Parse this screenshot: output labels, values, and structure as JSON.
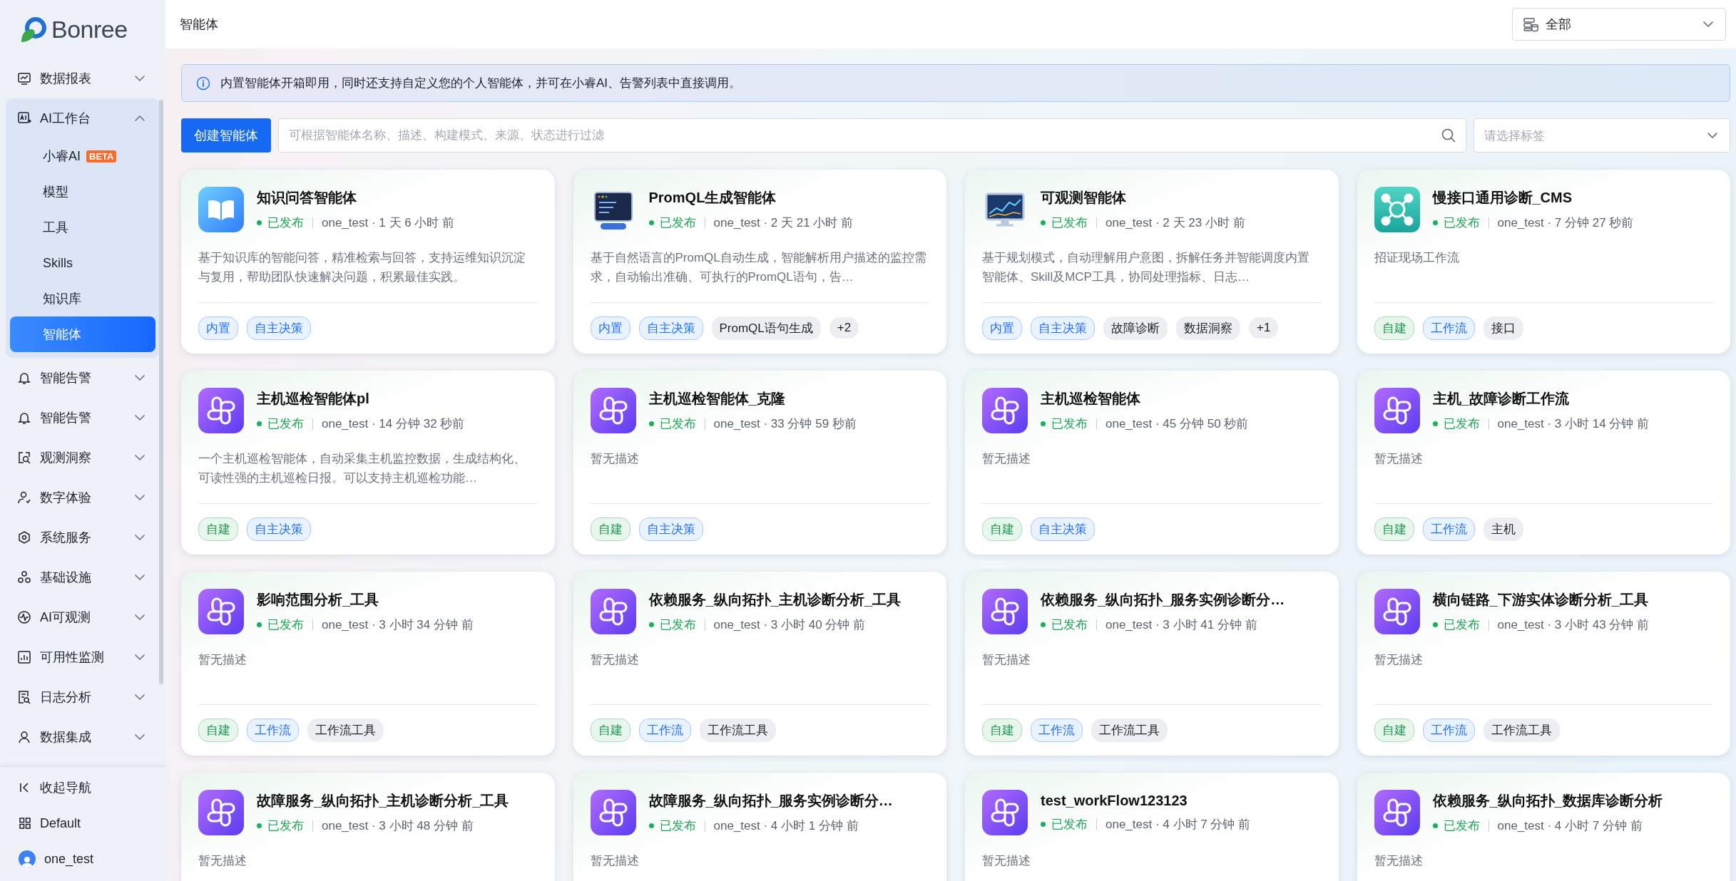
{
  "sidebar": {
    "logo": "Bonree",
    "items": [
      {
        "label": "数据报表",
        "expanded": false
      },
      {
        "label": "AI工作台",
        "expanded": true,
        "children": [
          {
            "label": "小睿AI",
            "badge": "BETA",
            "selected": false
          },
          {
            "label": "模型",
            "selected": false
          },
          {
            "label": "工具",
            "selected": false
          },
          {
            "label": "Skills",
            "selected": false
          },
          {
            "label": "知识库",
            "selected": false
          },
          {
            "label": "智能体",
            "selected": true
          }
        ]
      },
      {
        "label": "智能告警",
        "expanded": false
      },
      {
        "label": "智能告警",
        "expanded": false
      },
      {
        "label": "观测洞察",
        "expanded": false
      },
      {
        "label": "数字体验",
        "expanded": false
      },
      {
        "label": "系统服务",
        "expanded": false
      },
      {
        "label": "基础设施",
        "expanded": false
      },
      {
        "label": "AI可观测",
        "expanded": false
      },
      {
        "label": "可用性监测",
        "expanded": false
      },
      {
        "label": "日志分析",
        "expanded": false
      },
      {
        "label": "数据集成",
        "expanded": false
      }
    ],
    "footer": {
      "collapse": "收起导航",
      "workspace": "Default",
      "user": "one_test"
    }
  },
  "header": {
    "title": "智能体",
    "scope_select": "全部"
  },
  "banner": "内置智能体开箱即用，同时还支持自定义您的个人智能体，并可在小睿AI、告警列表中直接调用。",
  "toolbar": {
    "create_button": "创建智能体",
    "search": {
      "placeholder": "可根据智能体名称、描述、构建模式、来源、状态进行过滤"
    },
    "tag_select": {
      "placeholder": "请选择标签"
    }
  },
  "cards": [
    {
      "kind": "book",
      "title": "知识问答智能体",
      "status": "已发布",
      "meta": "one_test · 1 天 6 小时 前",
      "description": "基于知识库的智能问答，精准检索与回答，支持运维知识沉淀与复用，帮助团队快速解决问题，积累最佳实践。",
      "tags": [
        {
          "label": "内置",
          "kind": "source"
        },
        {
          "label": "自主决策",
          "kind": "mode"
        }
      ]
    },
    {
      "kind": "terminal",
      "title": "PromQL生成智能体",
      "status": "已发布",
      "meta": "one_test · 2 天 21 小时 前",
      "description": "基于自然语言的PromQL自动生成，智能解析用户描述的监控需求，自动输出准确、可执行的PromQL语句，告…",
      "tags": [
        {
          "label": "内置",
          "kind": "source"
        },
        {
          "label": "自主决策",
          "kind": "mode"
        },
        {
          "label": "PromQL语句生成",
          "kind": "label"
        },
        {
          "label": "+2",
          "kind": "label"
        }
      ]
    },
    {
      "kind": "monitor",
      "title": "可观测智能体",
      "status": "已发布",
      "meta": "one_test · 2 天 23 小时 前",
      "description": "基于规划模式，自动理解用户意图，拆解任务并智能调度内置智能体、Skill及MCP工具，协同处理指标、日志…",
      "tags": [
        {
          "label": "内置",
          "kind": "source"
        },
        {
          "label": "自主决策",
          "kind": "mode"
        },
        {
          "label": "故障诊断",
          "kind": "label"
        },
        {
          "label": "数据洞察",
          "kind": "label"
        },
        {
          "label": "+1",
          "kind": "label"
        }
      ]
    },
    {
      "kind": "network",
      "title": "慢接口通用诊断_CMS",
      "status": "已发布",
      "meta": "one_test · 7 分钟 27 秒前",
      "description": "招证现场工作流",
      "tags": [
        {
          "label": "自建",
          "kind": "custom"
        },
        {
          "label": "工作流",
          "kind": "mode"
        },
        {
          "label": "接口",
          "kind": "label"
        }
      ]
    },
    {
      "kind": "workflow",
      "title": "主机巡检智能体pl",
      "status": "已发布",
      "meta": "one_test · 14 分钟 32 秒前",
      "description": "一个主机巡检智能体，自动采集主机监控数据，生成结构化、可读性强的主机巡检日报。可以支持主机巡检功能…",
      "tags": [
        {
          "label": "自建",
          "kind": "custom"
        },
        {
          "label": "自主决策",
          "kind": "mode"
        }
      ]
    },
    {
      "kind": "workflow",
      "title": "主机巡检智能体_克隆",
      "status": "已发布",
      "meta": "one_test · 33 分钟 59 秒前",
      "description": "暂无描述",
      "tags": [
        {
          "label": "自建",
          "kind": "custom"
        },
        {
          "label": "自主决策",
          "kind": "mode"
        }
      ]
    },
    {
      "kind": "workflow",
      "title": "主机巡检智能体",
      "status": "已发布",
      "meta": "one_test · 45 分钟 50 秒前",
      "description": "暂无描述",
      "tags": [
        {
          "label": "自建",
          "kind": "custom"
        },
        {
          "label": "自主决策",
          "kind": "mode"
        }
      ]
    },
    {
      "kind": "workflow",
      "title": "主机_故障诊断工作流",
      "status": "已发布",
      "meta": "one_test · 3 小时 14 分钟 前",
      "description": "暂无描述",
      "tags": [
        {
          "label": "自建",
          "kind": "custom"
        },
        {
          "label": "工作流",
          "kind": "mode"
        },
        {
          "label": "主机",
          "kind": "label"
        }
      ]
    },
    {
      "kind": "workflow",
      "title": "影响范围分析_工具",
      "status": "已发布",
      "meta": "one_test · 3 小时 34 分钟 前",
      "description": "暂无描述",
      "tags": [
        {
          "label": "自建",
          "kind": "custom"
        },
        {
          "label": "工作流",
          "kind": "mode"
        },
        {
          "label": "工作流工具",
          "kind": "label"
        }
      ]
    },
    {
      "kind": "workflow",
      "title": "依赖服务_纵向拓扑_主机诊断分析_工具",
      "status": "已发布",
      "meta": "one_test · 3 小时 40 分钟 前",
      "description": "暂无描述",
      "tags": [
        {
          "label": "自建",
          "kind": "custom"
        },
        {
          "label": "工作流",
          "kind": "mode"
        },
        {
          "label": "工作流工具",
          "kind": "label"
        }
      ]
    },
    {
      "kind": "workflow",
      "title": "依赖服务_纵向拓扑_服务实例诊断分…",
      "status": "已发布",
      "meta": "one_test · 3 小时 41 分钟 前",
      "description": "暂无描述",
      "tags": [
        {
          "label": "自建",
          "kind": "custom"
        },
        {
          "label": "工作流",
          "kind": "mode"
        },
        {
          "label": "工作流工具",
          "kind": "label"
        }
      ]
    },
    {
      "kind": "workflow",
      "title": "横向链路_下游实体诊断分析_工具",
      "status": "已发布",
      "meta": "one_test · 3 小时 43 分钟 前",
      "description": "暂无描述",
      "tags": [
        {
          "label": "自建",
          "kind": "custom"
        },
        {
          "label": "工作流",
          "kind": "mode"
        },
        {
          "label": "工作流工具",
          "kind": "label"
        }
      ]
    },
    {
      "kind": "workflow",
      "title": "故障服务_纵向拓扑_主机诊断分析_工具",
      "status": "已发布",
      "meta": "one_test · 3 小时 48 分钟 前",
      "description": "暂无描述"
    },
    {
      "kind": "workflow",
      "title": "故障服务_纵向拓扑_服务实例诊断分…",
      "status": "已发布",
      "meta": "one_test · 4 小时 1 分钟 前",
      "description": "暂无描述"
    },
    {
      "kind": "workflow",
      "title": "test_workFlow123123",
      "status": "已发布",
      "meta": "one_test · 4 小时 7 分钟 前",
      "description": "暂无描述"
    },
    {
      "kind": "workflow",
      "title": "依赖服务_纵向拓扑_数据库诊断分析",
      "status": "已发布",
      "meta": "one_test · 4 小时 7 分钟 前",
      "description": "暂无描述"
    }
  ]
}
